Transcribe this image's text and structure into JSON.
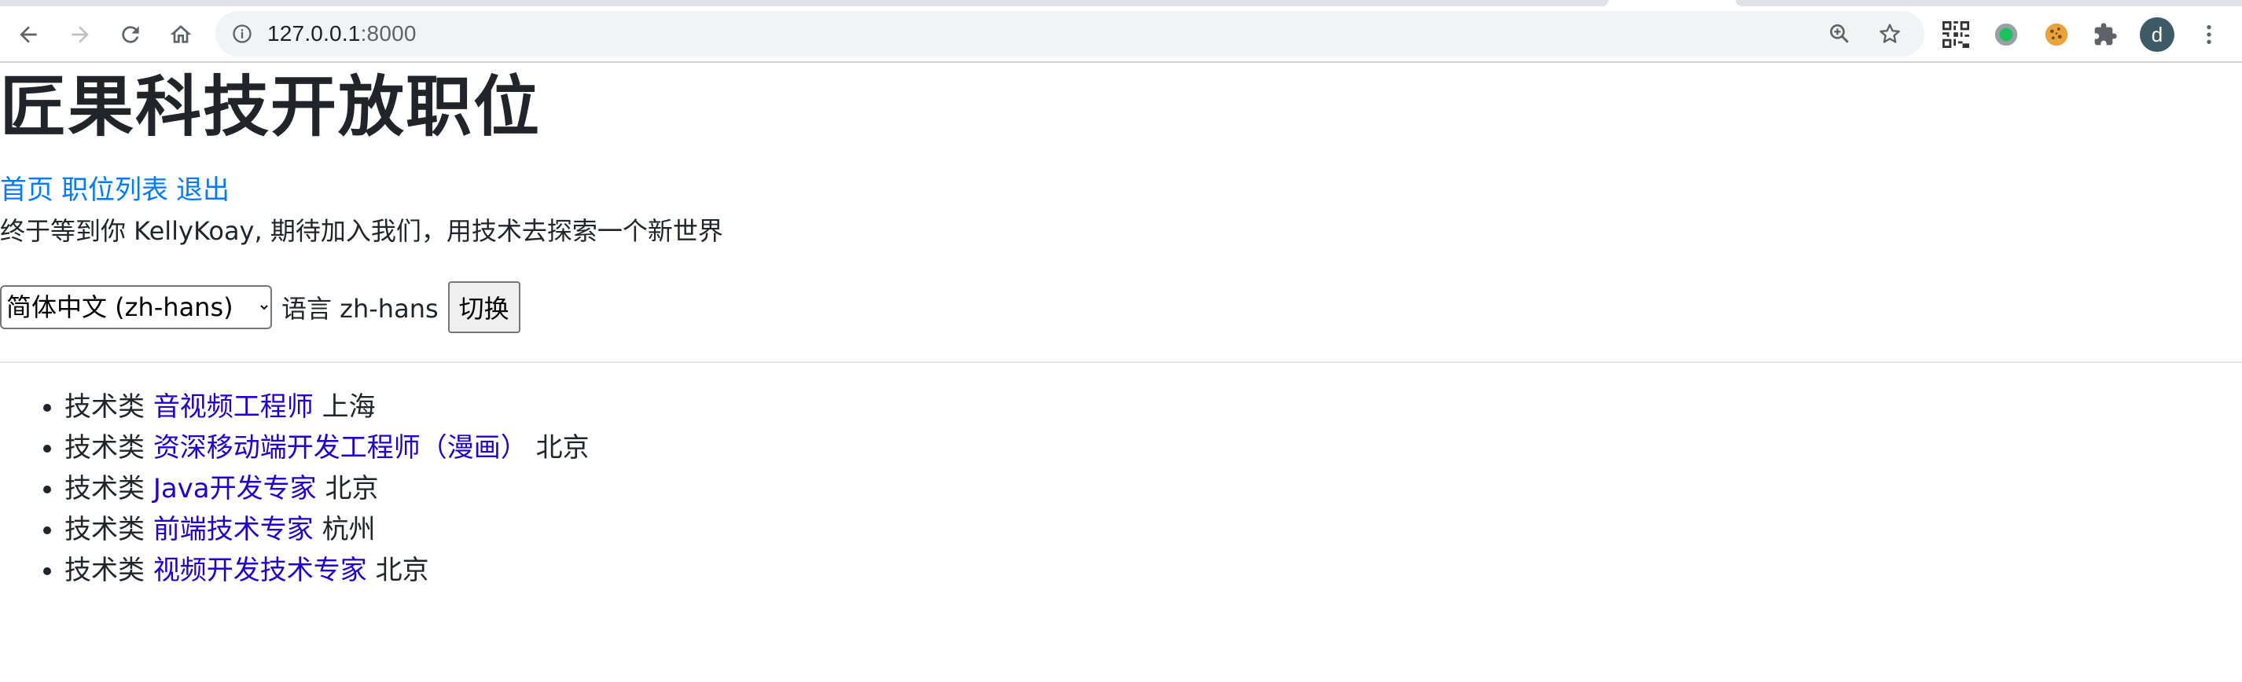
{
  "browser": {
    "url_host": "127.0.0.1",
    "url_port": ":8000",
    "avatar_letter": "d",
    "icons": {
      "back": "arrow-left-icon",
      "forward": "arrow-right-icon",
      "reload": "reload-icon",
      "home": "home-icon",
      "info": "info-icon",
      "zoom": "zoom-in-icon",
      "bookmark": "star-icon",
      "qr": "qr-code-icon",
      "green_ext": "green-circle-extension-icon",
      "cookie": "cookie-icon",
      "extensions": "puzzle-icon",
      "menu": "kebab-menu-icon"
    }
  },
  "page": {
    "title": "匠果科技开放职位",
    "nav": {
      "home": "首页",
      "job_list": "职位列表",
      "logout": "退出"
    },
    "welcome": "终于等到你 KellyKoay, 期待加入我们，用技术去探索一个新世界",
    "language": {
      "selected": "简体中文 (zh-hans)",
      "label": "语言 zh-hans",
      "button": "切换"
    },
    "jobs": [
      {
        "category": "技术类",
        "title": "音视频工程师",
        "city": "上海"
      },
      {
        "category": "技术类",
        "title": "资深移动端开发工程师（漫画）",
        "city": "北京"
      },
      {
        "category": "技术类",
        "title": "Java开发专家",
        "city": "北京"
      },
      {
        "category": "技术类",
        "title": "前端技术专家",
        "city": "杭州"
      },
      {
        "category": "技术类",
        "title": "视频开发技术专家",
        "city": "北京"
      }
    ]
  },
  "colors": {
    "link_nav": "#007bff",
    "link_job": "#2200cc",
    "text": "#212529",
    "avatar_bg": "#3d5a66"
  }
}
